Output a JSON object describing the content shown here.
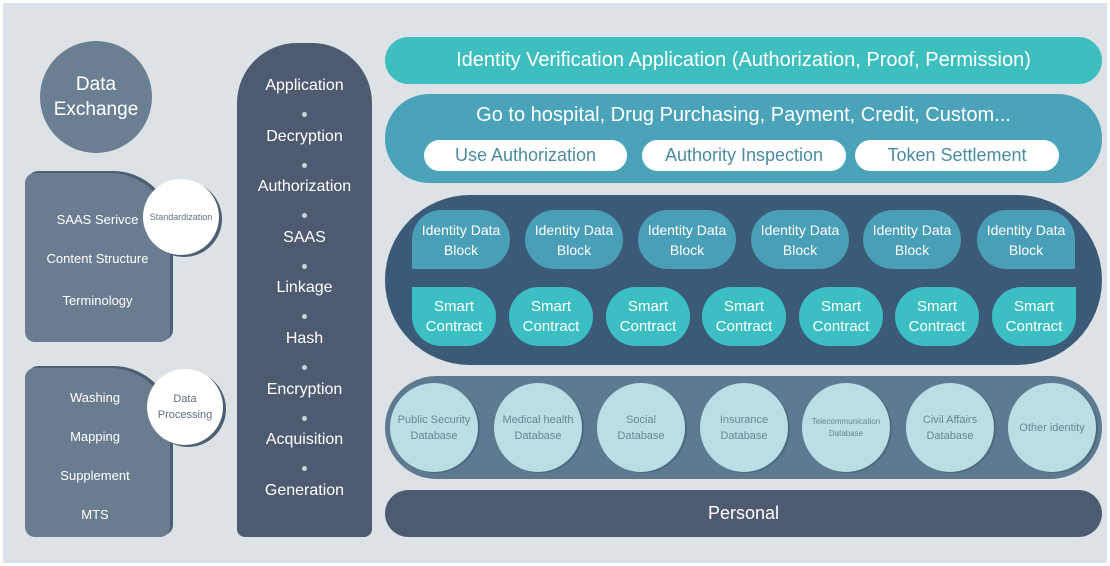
{
  "data_exchange": "Data Exchange",
  "standardization": {
    "badge": "Standardization",
    "items": [
      "SAAS Serivce",
      "Content Structure",
      "Terminology"
    ]
  },
  "processing": {
    "badge": "Data Processing",
    "items": [
      "Washing",
      "Mapping",
      "Supplement",
      "MTS"
    ]
  },
  "stack": [
    "Application",
    "Decryption",
    "Authorization",
    "SAAS",
    "Linkage",
    "Hash",
    "Encryption",
    "Acquisition",
    "Generation"
  ],
  "top_bar": "Identity Verification Application (Authorization, Proof, Permission)",
  "scenarios": {
    "title": "Go to hospital, Drug Purchasing, Payment, Credit, Custom...",
    "pills": [
      "Use Authorization",
      "Authority Inspection",
      "Token Settlement"
    ]
  },
  "identity_blocks": [
    "Identity Data Block",
    "Identity Data Block",
    "Identity Data Block",
    "Identity Data Block",
    "Identity Data Block",
    "Identity Data Block"
  ],
  "smart_contracts": [
    "Smart Contract",
    "Smart Contract",
    "Smart Contract",
    "Smart Contract",
    "Smart Contract",
    "Smart Contract",
    "Smart Contract"
  ],
  "databases": [
    "Public Security Database",
    "Medical health Database",
    "Social Database",
    "Insurance Database",
    "Telecommunication Database",
    "Civil Affairs Database",
    "Other identity"
  ],
  "personal": "Personal",
  "colors": {
    "teal": "#3dbfbf",
    "slate": "#4d5a70",
    "chain": "#3b5a78",
    "block": "#4a9fb8",
    "contract": "#3bbfc2",
    "db": "#b9dfe4"
  }
}
